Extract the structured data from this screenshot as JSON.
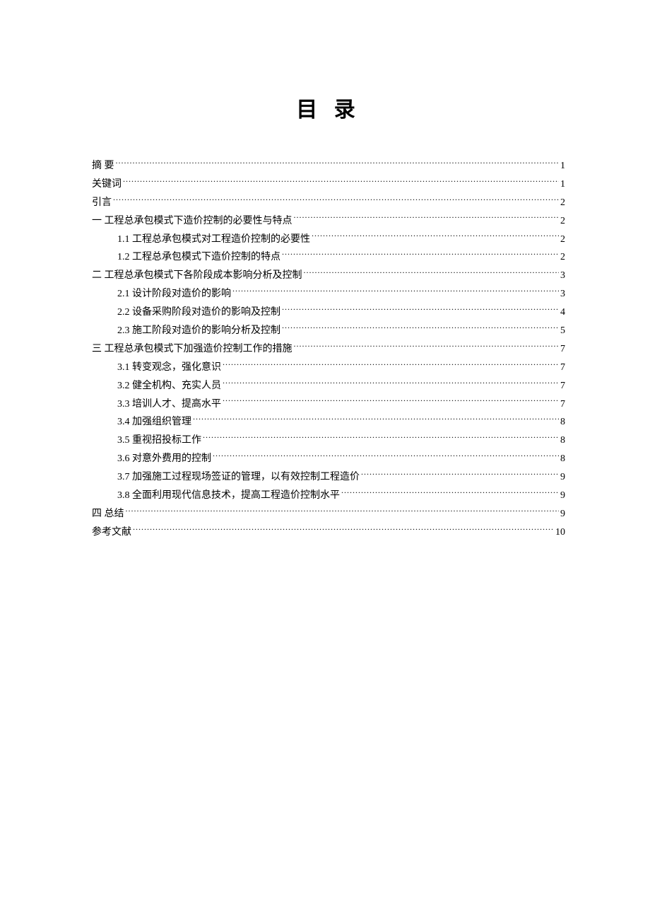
{
  "title": "目 录",
  "toc": [
    {
      "label": "摘 要",
      "page": "1",
      "indent": false
    },
    {
      "label": "关键词",
      "page": "1",
      "indent": false
    },
    {
      "label": "引言",
      "page": "2",
      "indent": false
    },
    {
      "label": "一 工程总承包模式下造价控制的必要性与特点",
      "page": "2",
      "indent": false
    },
    {
      "label": "1.1  工程总承包模式对工程造价控制的必要性 ",
      "page": "2",
      "indent": true
    },
    {
      "label": "1.2 工程总承包模式下造价控制的特点",
      "page": "2",
      "indent": true
    },
    {
      "label": "二 工程总承包模式下各阶段成本影响分析及控制",
      "page": "3",
      "indent": false
    },
    {
      "label": "2.1  设计阶段对造价的影响",
      "page": "3",
      "indent": true
    },
    {
      "label": "2.2  设备采购阶段对造价的影响及控制",
      "page": "4",
      "indent": true
    },
    {
      "label": "2.3  施工阶段对造价的影响分析及控制",
      "page": "5",
      "indent": true
    },
    {
      "label": "三 工程总承包模式下加强造价控制工作的措施",
      "page": "7",
      "indent": false
    },
    {
      "label": "3.1  转变观念，强化意识",
      "page": "7",
      "indent": true
    },
    {
      "label": "3.2  健全机构、充实人员",
      "page": "7",
      "indent": true
    },
    {
      "label": "3.3  培训人才、提高水平",
      "page": "7",
      "indent": true
    },
    {
      "label": "3.4 加强组织管理",
      "page": "8",
      "indent": true
    },
    {
      "label": "3.5  重视招投标工作",
      "page": "8",
      "indent": true
    },
    {
      "label": "3.6  对意外费用的控制",
      "page": "8",
      "indent": true
    },
    {
      "label": "3.7 加强施工过程现场签证的管理，以有效控制工程造价",
      "page": "9",
      "indent": true
    },
    {
      "label": "3.8 全面利用现代信息技术，提高工程造价控制水平",
      "page": "9",
      "indent": true
    },
    {
      "label": "四  总结",
      "page": "9",
      "indent": false
    },
    {
      "label": "参考文献",
      "page": "10",
      "indent": false
    }
  ]
}
